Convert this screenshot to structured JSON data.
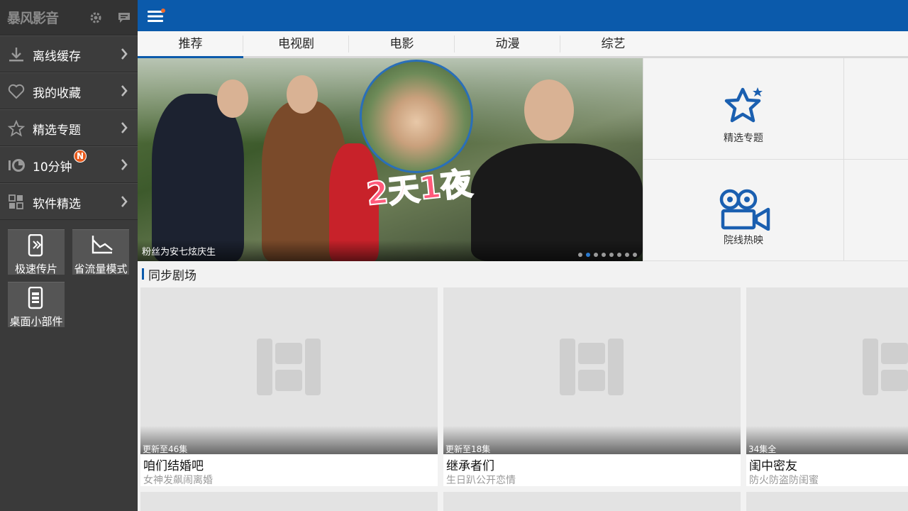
{
  "app": {
    "logo": "暴风影音"
  },
  "sidebar": {
    "items": [
      {
        "label": "离线缓存",
        "icon": "download-icon"
      },
      {
        "label": "我的收藏",
        "icon": "heart-icon"
      },
      {
        "label": "精选专题",
        "icon": "star-icon"
      },
      {
        "label": "10分钟",
        "icon": "ten-minutes-icon",
        "badge": "N"
      },
      {
        "label": "软件精选",
        "icon": "apps-grid-icon"
      }
    ],
    "tiles": [
      {
        "label": "极速传片",
        "icon": "phone-transfer-icon"
      },
      {
        "label": "省流量模式",
        "icon": "data-saver-icon"
      },
      {
        "label": "桌面小部件",
        "icon": "widget-icon"
      }
    ]
  },
  "tabs": [
    {
      "label": "推荐",
      "active": true
    },
    {
      "label": "电视剧"
    },
    {
      "label": "电影"
    },
    {
      "label": "动漫"
    },
    {
      "label": "综艺"
    }
  ],
  "banner": {
    "caption": "粉丝为安七炫庆生",
    "logo_text": "2天1夜",
    "dot_count": 8,
    "active_dot": 1
  },
  "features": [
    {
      "label": "精选专题",
      "icon": "star-icon"
    },
    {
      "label": "院线热映",
      "icon": "film-camera-icon"
    }
  ],
  "section": {
    "title": "同步剧场"
  },
  "cards": [
    {
      "episodes": "更新至46集",
      "title": "咱们结婚吧",
      "subtitle": "女神发飙闹离婚"
    },
    {
      "episodes": "更新至18集",
      "title": "继承者们",
      "subtitle": "生日趴公开恋情"
    },
    {
      "episodes": "34集全",
      "title": "闺中密友",
      "subtitle": "防火防盗防闺蜜"
    }
  ],
  "colors": {
    "brand_blue": "#0b5aab",
    "sidebar_bg": "#3a3a3a",
    "badge": "#e85a1c"
  }
}
